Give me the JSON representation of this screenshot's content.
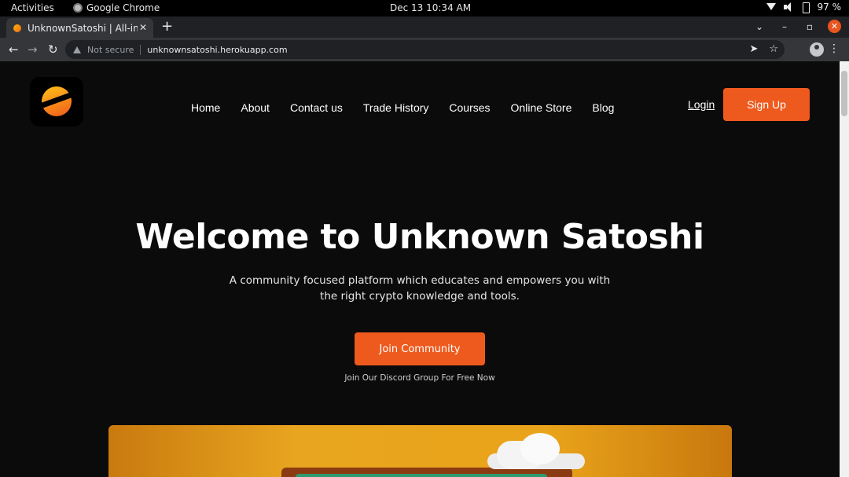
{
  "os_bar": {
    "activities": "Activities",
    "app_name": "Google Chrome",
    "clock": "Dec 13  10:34 AM",
    "battery": "97 %"
  },
  "browser": {
    "tab_title": "UnknownSatoshi | All-in-C",
    "security_label": "Not secure",
    "url": "unknownsatoshi.herokuapp.com"
  },
  "site": {
    "nav": [
      {
        "label": "Home"
      },
      {
        "label": "About"
      },
      {
        "label": "Contact us"
      },
      {
        "label": "Trade History"
      },
      {
        "label": "Courses"
      },
      {
        "label": "Online Store"
      },
      {
        "label": "Blog"
      }
    ],
    "login_label": "Login",
    "signup_label": "Sign Up",
    "accent_color": "#ee5a1d"
  },
  "hero": {
    "title": "Welcome to Unknown Satoshi",
    "subtitle": "A community focused platform which educates and empowers you with the right crypto knowledge and tools.",
    "cta_label": "Join Community",
    "cta_note": "Join Our Discord Group For Free Now"
  }
}
